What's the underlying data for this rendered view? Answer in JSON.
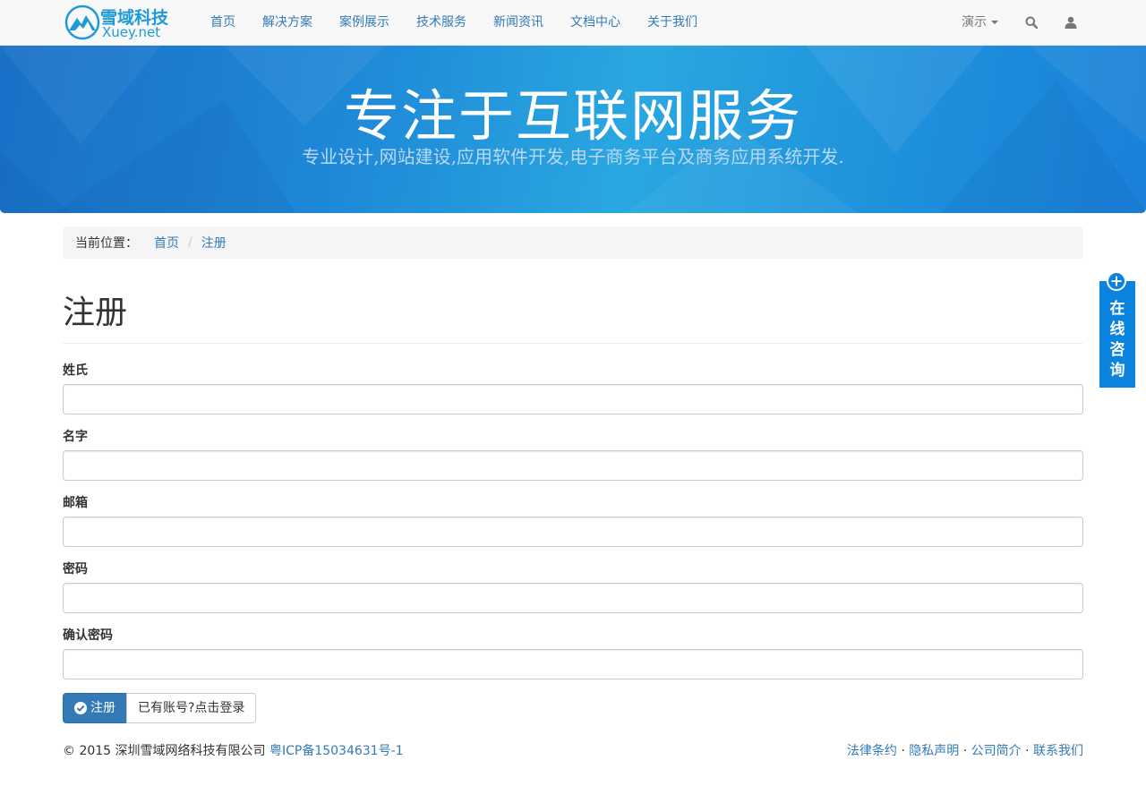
{
  "brand": {
    "name_cn": "雪域科技",
    "name_en": "Xuey.net"
  },
  "nav": {
    "links": [
      "首页",
      "解决方案",
      "案例展示",
      "技术服务",
      "新闻资讯",
      "文档中心",
      "关于我们"
    ],
    "demo_label": "演示",
    "search_icon": "search-icon",
    "user_icon": "user-icon"
  },
  "banner": {
    "title": "专注于互联网服务",
    "subtitle": "专业设计,网站建设,应用软件开发,电子商务平台及商务应用系统开发."
  },
  "breadcrumb": {
    "lead": "当前位置：",
    "home": "首页",
    "current": "注册"
  },
  "page": {
    "title": "注册"
  },
  "form": {
    "fields": [
      {
        "label": "姓氏",
        "value": ""
      },
      {
        "label": "名字",
        "value": ""
      },
      {
        "label": "邮箱",
        "value": ""
      },
      {
        "label": "密码",
        "value": ""
      },
      {
        "label": "确认密码",
        "value": ""
      }
    ],
    "submit_label": "注册",
    "login_label": "已有账号?点击登录"
  },
  "footer": {
    "copyright": "© 2015 深圳雪域网络科技有限公司",
    "icp": "粤ICP备15034631号-1",
    "links": [
      "法律条约",
      "隐私声明",
      "公司简介",
      "联系我们"
    ],
    "separator": " · "
  },
  "consult": {
    "text": "在线咨询"
  },
  "colors": {
    "link": "#337ab7",
    "primary": "#337ab7",
    "banner": "#1e88d8",
    "consult": "#0b84e0"
  }
}
